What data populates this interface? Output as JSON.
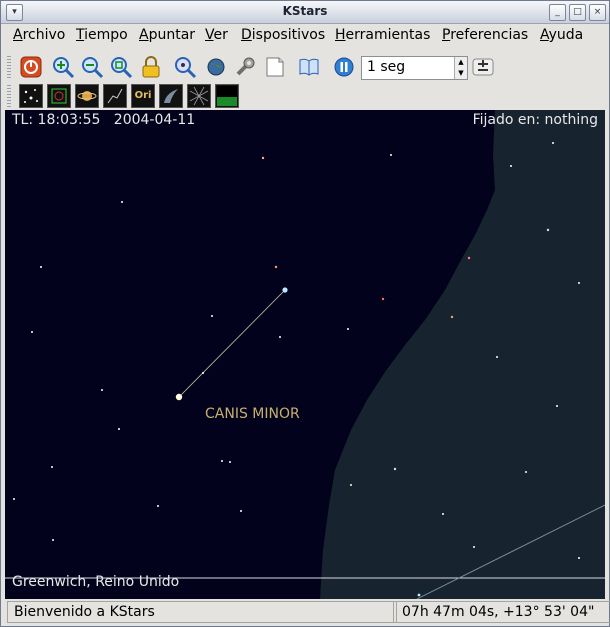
{
  "window": {
    "title": "KStars"
  },
  "titlebar_buttons": {
    "minimize": "_",
    "maximize": "□",
    "close": "×",
    "menu": "▾"
  },
  "menu": [
    "Archivo",
    "Tiempo",
    "Apuntar",
    "Ver",
    "Dispositivos",
    "Herramientas",
    "Preferencias",
    "Ayuda"
  ],
  "toolbar": {
    "time_step": "1 seg",
    "icons": [
      "power-icon",
      "zoom-in-icon",
      "zoom-out-icon",
      "zoom-default-icon",
      "lock-icon",
      "find-object-icon",
      "globe-icon",
      "wrench-icon",
      "note-icon",
      "book-icon",
      "pause-icon"
    ]
  },
  "view_toolbar": {
    "buttons": [
      {
        "name": "stars-toggle",
        "label": ""
      },
      {
        "name": "deep-sky-toggle",
        "label": ""
      },
      {
        "name": "solar-system-toggle",
        "label": ""
      },
      {
        "name": "constellation-lines-toggle",
        "label": ""
      },
      {
        "name": "constellation-names-toggle",
        "label": "Ori"
      },
      {
        "name": "milky-way-toggle",
        "label": ""
      },
      {
        "name": "coordinate-grid-toggle",
        "label": ""
      },
      {
        "name": "horizon-toggle",
        "label": ""
      }
    ]
  },
  "sky": {
    "time_label": "TL:",
    "time": "18:03:55",
    "date": "2004-04-11",
    "focus_label": "Fijado en:",
    "focus_object": "nothing",
    "constellation": "CANIS MINOR",
    "location": "Greenwich, Reino Unido",
    "colors": {
      "night": "#02021c",
      "milky_way": "#17242f",
      "constellation_line": "#c8c8a8",
      "constellation_name": "#c8b070"
    }
  },
  "status": {
    "message": "Bienvenido a KStars",
    "coords": "07h 47m 04s,  +13° 53' 04\""
  }
}
